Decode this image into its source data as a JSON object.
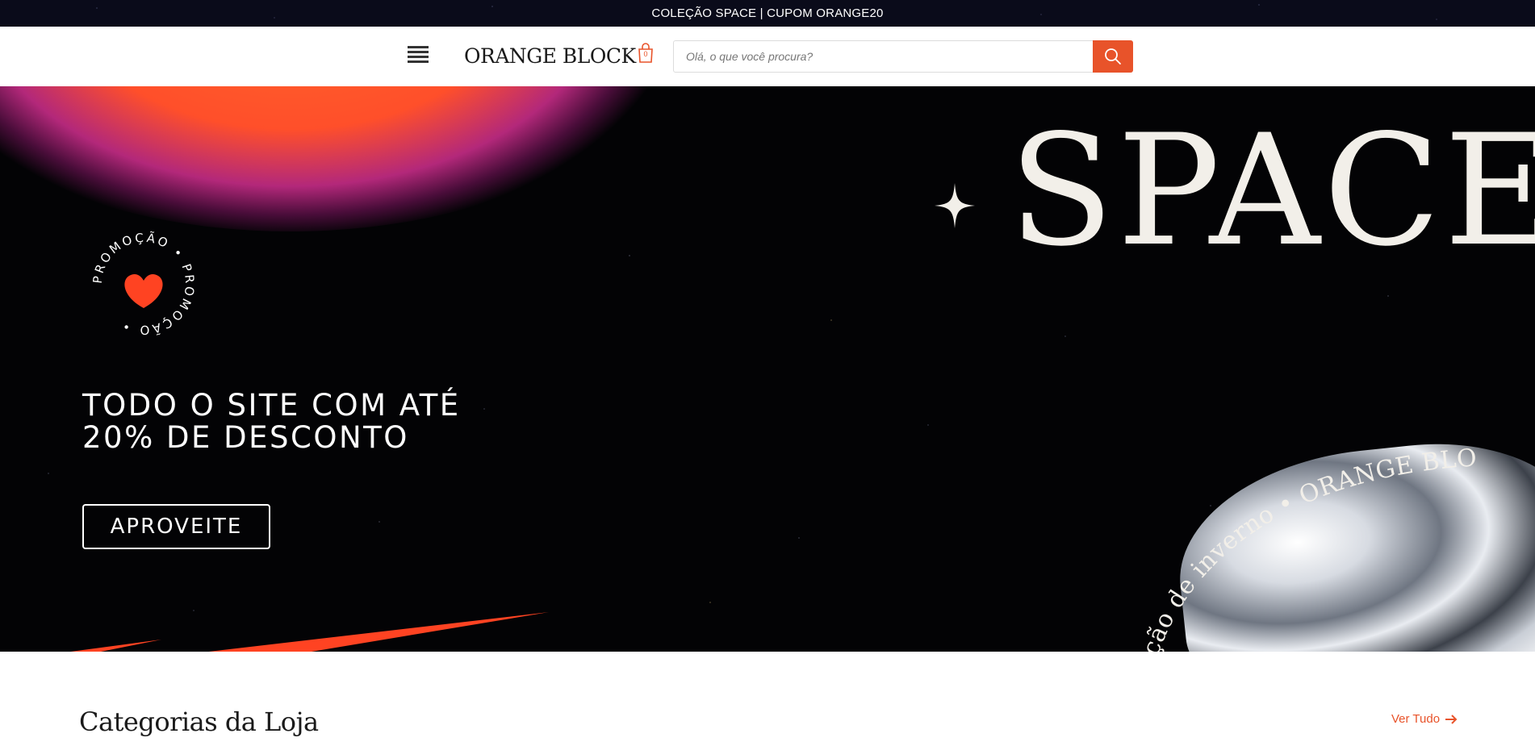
{
  "announcement": {
    "text": "COLEÇÃO SPACE | CUPOM ORANGE20"
  },
  "header": {
    "menu_icon": "hamburger-menu-icon",
    "logo_text": "ORANGE BLOCK",
    "cart": {
      "icon": "shopping-bag-icon",
      "count": "0"
    },
    "search": {
      "placeholder": "Olá, o que você procura?",
      "value": "",
      "button_icon": "search-icon"
    }
  },
  "hero": {
    "badge_text": "PROMOÇÃO • PROMOÇÃO •",
    "badge_icon": "heart-icon",
    "headline_line1": "TODO O SITE COM ATÉ",
    "headline_line2": "20% DE DESCONTO",
    "cta_label": "APROVEITE",
    "title": "SPACE",
    "arc_text": "coleção de inverno • ORANGE BLOCK"
  },
  "categories": {
    "title": "Categorias da Loja",
    "see_all_label": "Ver Tudo",
    "see_all_icon": "arrow-right-icon"
  },
  "colors": {
    "accent": "#e8532a",
    "dark": "#030305",
    "cream": "#f2efe9"
  }
}
